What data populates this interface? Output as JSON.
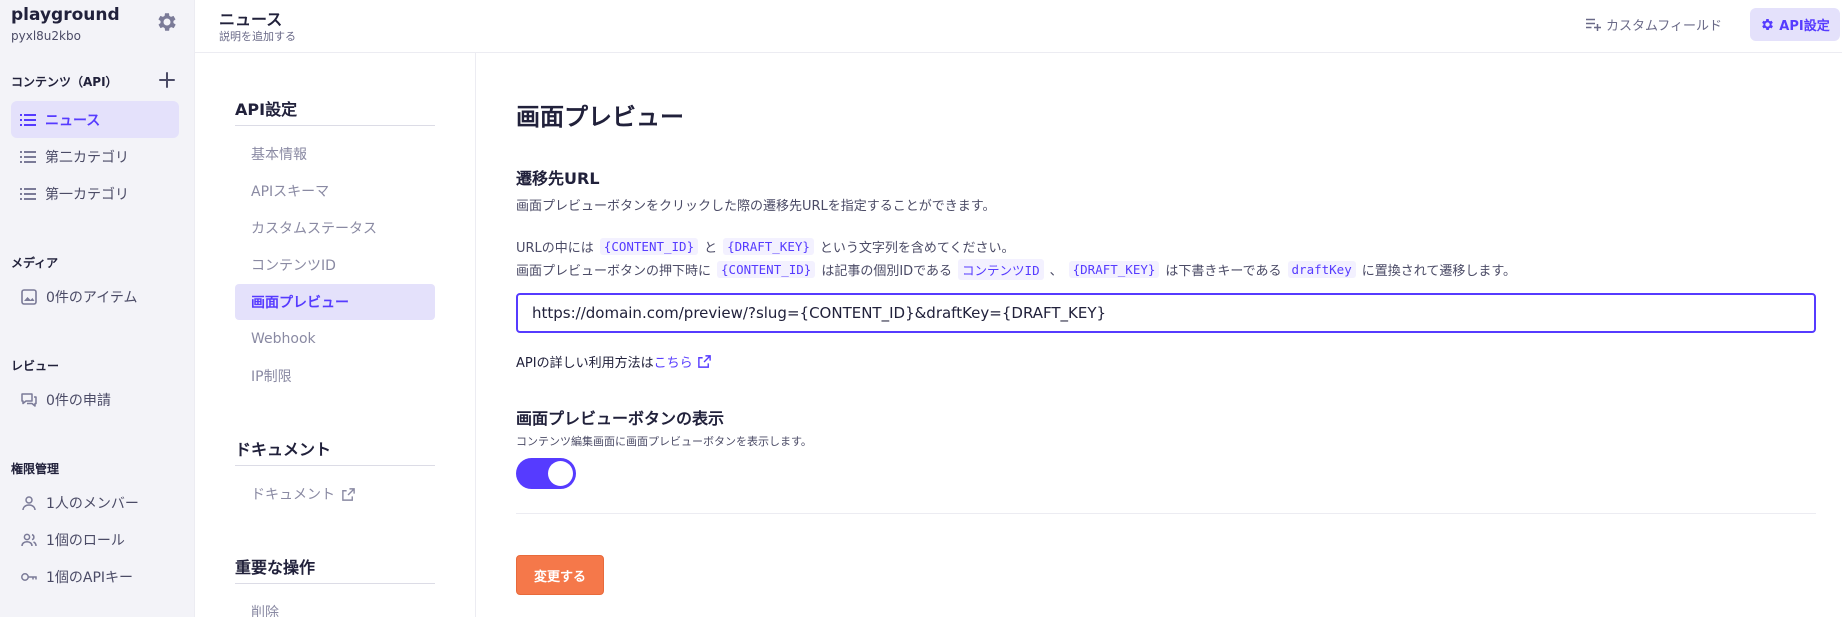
{
  "service": {
    "name": "playground",
    "id": "pyxl8u2kbo"
  },
  "sidebar": {
    "contents_label": "コンテンツ（API）",
    "contents_items": [
      {
        "label": "ニュース"
      },
      {
        "label": "第二カテゴリ"
      },
      {
        "label": "第一カテゴリ"
      }
    ],
    "media_label": "メディア",
    "media_item": "0件のアイテム",
    "review_label": "レビュー",
    "review_item": "0件の申請",
    "perm_label": "権限管理",
    "perm_items": [
      {
        "label": "1人のメンバー"
      },
      {
        "label": "1個のロール"
      },
      {
        "label": "1個のAPIキー"
      }
    ]
  },
  "header": {
    "title": "ニュース",
    "subtitle": "説明を追加する",
    "custom_fields": "カスタムフィールド",
    "api_settings": "API設定"
  },
  "menu": {
    "api_head": "API設定",
    "api_items": [
      {
        "label": "基本情報"
      },
      {
        "label": "APIスキーマ"
      },
      {
        "label": "カスタムステータス"
      },
      {
        "label": "コンテンツID"
      },
      {
        "label": "画面プレビュー"
      },
      {
        "label": "Webhook"
      },
      {
        "label": "IP制限"
      }
    ],
    "doc_head": "ドキュメント",
    "doc_item": "ドキュメント",
    "danger_head": "重要な操作",
    "danger_item": "削除"
  },
  "main": {
    "title": "画面プレビュー",
    "url_title": "遷移先URL",
    "url_desc": "画面プレビューボタンをクリックした際の遷移先URLを指定することができます。",
    "note1": {
      "a": "URLの中には",
      "tag1": "{CONTENT_ID}",
      "b": "と",
      "tag2": "{DRAFT_KEY}",
      "c": "という文字列を含めてください。"
    },
    "note2": {
      "a": "画面プレビューボタンの押下時に",
      "tag1": "{CONTENT_ID}",
      "b": "は記事の個別IDである",
      "tag2": "コンテンツID",
      "c": "、",
      "tag3": "{DRAFT_KEY}",
      "d": "は下書きキーである",
      "tag4": "draftKey",
      "e": "に置換されて遷移します。"
    },
    "url_value": "https://domain.com/preview/?slug={CONTENT_ID}&draftKey={DRAFT_KEY}",
    "help_text": "APIの詳しい利用方法は",
    "help_link": "こちら",
    "toggle_title": "画面プレビューボタンの表示",
    "toggle_desc": "コンテンツ編集画面に画面プレビューボタンを表示します。",
    "toggle_on": true,
    "submit": "変更する"
  },
  "colors": {
    "accent": "#563bff",
    "accent_bg": "#e4e1fb",
    "submit": "#f5784a"
  }
}
